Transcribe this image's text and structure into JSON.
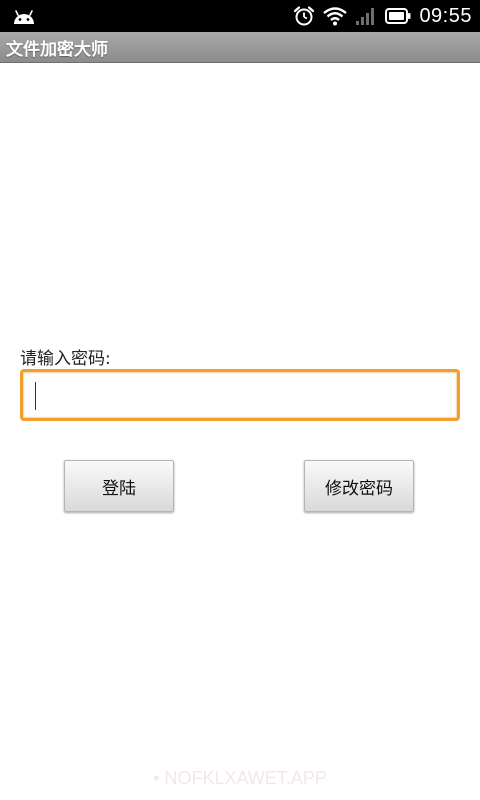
{
  "status_bar": {
    "time": "09:55",
    "icons": [
      "android-icon",
      "alarm-clock-icon",
      "wifi-icon",
      "signal-icon",
      "battery-icon"
    ]
  },
  "title_bar": {
    "title": "文件加密大师"
  },
  "login_form": {
    "prompt_label": "请输入密码:",
    "password_value": "",
    "accent_color": "#f0a030"
  },
  "buttons": {
    "login_label": "登陆",
    "change_password_label": "修改密码"
  },
  "watermark": {
    "text": "• NOFKLXAWET.APP"
  }
}
